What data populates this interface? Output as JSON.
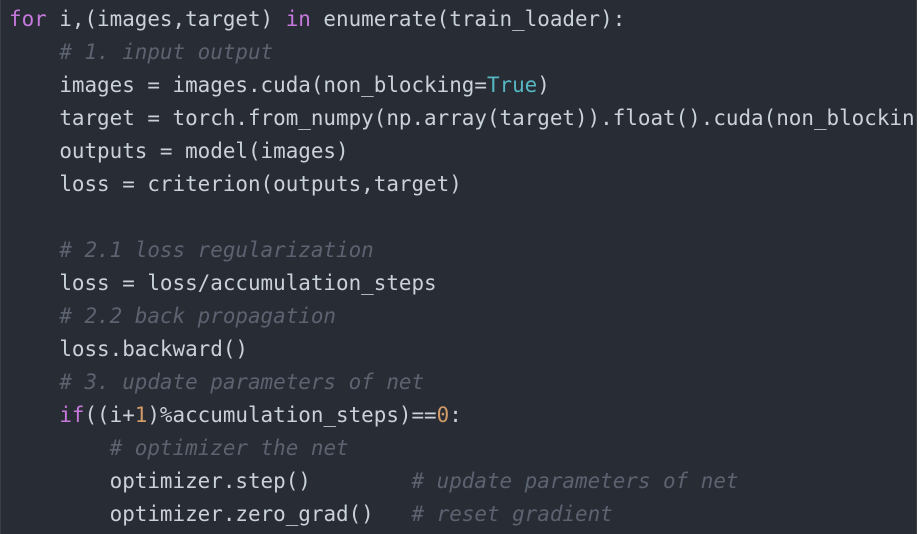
{
  "editor": {
    "language": "python",
    "colors": {
      "background": "#282c34",
      "text": "#c9d1d9",
      "keyword": "#c678dd",
      "builtin": "#56b6c2",
      "number": "#d19a66",
      "comment": "#5c6370"
    },
    "lines": [
      {
        "indent": "",
        "tokens": [
          {
            "t": "kw",
            "v": "for"
          },
          {
            "t": "tx",
            "v": " i,(images,target) "
          },
          {
            "t": "kw",
            "v": "in"
          },
          {
            "t": "tx",
            "v": " enumerate(train_loader):"
          }
        ]
      },
      {
        "indent": "    ",
        "tokens": [
          {
            "t": "cm",
            "v": "# 1. input output"
          }
        ]
      },
      {
        "indent": "    ",
        "tokens": [
          {
            "t": "tx",
            "v": "images = images.cuda(non_blocking="
          },
          {
            "t": "bi",
            "v": "True"
          },
          {
            "t": "tx",
            "v": ")"
          }
        ]
      },
      {
        "indent": "    ",
        "tokens": [
          {
            "t": "tx",
            "v": "target = torch.from_numpy(np.array(target)).float().cuda(non_blockin"
          }
        ]
      },
      {
        "indent": "    ",
        "tokens": [
          {
            "t": "tx",
            "v": "outputs = model(images)"
          }
        ]
      },
      {
        "indent": "    ",
        "tokens": [
          {
            "t": "tx",
            "v": "loss = criterion(outputs,target)"
          }
        ]
      },
      {
        "indent": "",
        "tokens": []
      },
      {
        "indent": "    ",
        "tokens": [
          {
            "t": "cm",
            "v": "# 2.1 loss regularization"
          }
        ]
      },
      {
        "indent": "    ",
        "tokens": [
          {
            "t": "tx",
            "v": "loss = loss/accumulation_steps"
          }
        ]
      },
      {
        "indent": "    ",
        "tokens": [
          {
            "t": "cm",
            "v": "# 2.2 back propagation"
          }
        ]
      },
      {
        "indent": "    ",
        "tokens": [
          {
            "t": "tx",
            "v": "loss.backward()"
          }
        ]
      },
      {
        "indent": "    ",
        "tokens": [
          {
            "t": "cm",
            "v": "# 3. update parameters of net"
          }
        ]
      },
      {
        "indent": "    ",
        "tokens": [
          {
            "t": "kw",
            "v": "if"
          },
          {
            "t": "tx",
            "v": "((i+"
          },
          {
            "t": "num",
            "v": "1"
          },
          {
            "t": "tx",
            "v": ")%accumulation_steps)=="
          },
          {
            "t": "num",
            "v": "0"
          },
          {
            "t": "tx",
            "v": ":"
          }
        ]
      },
      {
        "indent": "        ",
        "tokens": [
          {
            "t": "cm",
            "v": "# optimizer the net"
          }
        ]
      },
      {
        "indent": "        ",
        "tokens": [
          {
            "t": "tx",
            "v": "optimizer.step()        "
          },
          {
            "t": "cm",
            "v": "# update parameters of net"
          }
        ]
      },
      {
        "indent": "        ",
        "tokens": [
          {
            "t": "tx",
            "v": "optimizer.zero_grad()   "
          },
          {
            "t": "cm",
            "v": "# reset gradient"
          }
        ]
      }
    ]
  }
}
